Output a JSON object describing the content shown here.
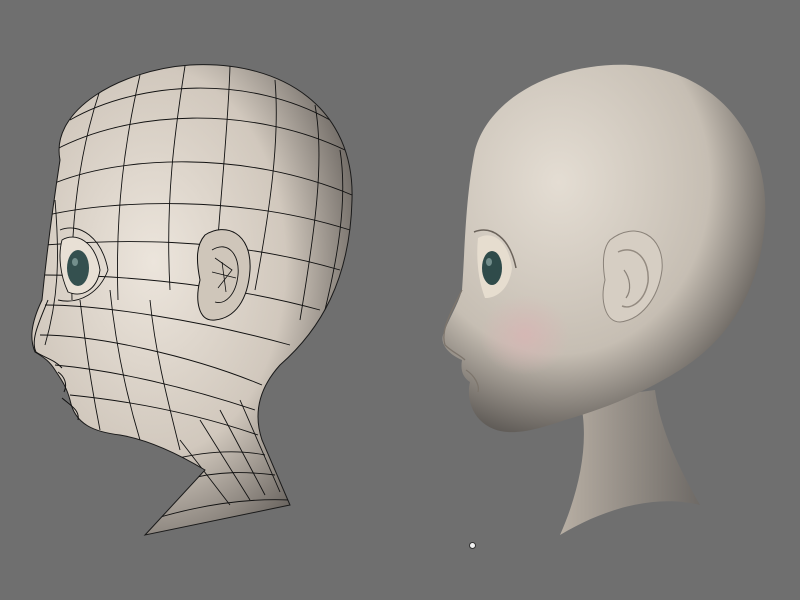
{
  "viewport": {
    "background_color": "#6f6f6f",
    "skin_color": "#d4cbc0",
    "wire_color": "#111111",
    "iris_color": "#34504f",
    "lip_blush_color": "#c9a7a7"
  },
  "models": [
    {
      "label": "",
      "display_mode": "wireframe-on-shaded"
    },
    {
      "label": "",
      "display_mode": "smooth-shaded"
    }
  ]
}
